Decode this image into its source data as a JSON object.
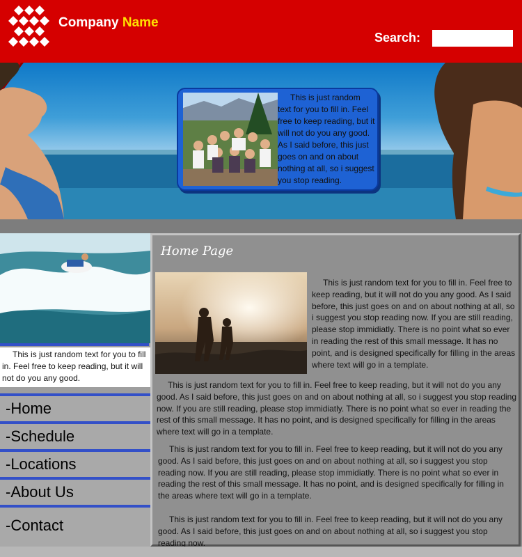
{
  "header": {
    "brand_first": "Company",
    "brand_second": "Name",
    "search_label": "Search:",
    "search_value": ""
  },
  "hero": {
    "card_text": "This is just random text for you to fill in.  Feel free to keep reading, but it will not do you any good.  As I said before, this just goes on and on about nothing at all, so i suggest you stop reading."
  },
  "sidebar": {
    "blurb": "This is just random text for you to fill in.  Feel free to keep reading, but it will not do you any good.",
    "nav": [
      {
        "label": "-Home"
      },
      {
        "label": "-Schedule"
      },
      {
        "label": "-Locations"
      },
      {
        "label": "-About Us"
      },
      {
        "label": "-Contact"
      }
    ]
  },
  "main": {
    "title": "Home Page",
    "paragraphs": [
      "This is just random text for you to fill in.  Feel free to keep reading, but it will not do you any good.  As I said before, this just goes on and on about nothing at all, so i suggest you stop reading now.  If you are still reading, please stop immidiatly.  There is no point what so ever in reading the rest of this small message.  It has no point, and is designed specifically for filling in the areas where text will go in a template.",
      "This is just random text for you to fill in.  Feel free to keep reading, but it will not do you any good.  As I said before, this just goes on and on about nothing at all, so i suggest you stop reading now.  If you are still reading, please stop immidiatly.  There is no point what so ever in reading the rest of this small message.  It has no point, and is designed specifically for filling in the areas where text will go in a template.",
      "This is just random text for you to fill in.  Feel free to keep reading, but it will not do you any good.  As I said before, this just goes on and on about nothing at all, so i suggest you stop reading now.  If you are still reading, please stop immidiatly.  There is no point what so ever in reading the rest of this small message.  It has no point, and is designed specifically for filling in the areas where text will go in a template.",
      "This is just random text for you to fill in.  Feel free to keep reading, but it will not do you any good.  As I said before, this just goes on and on about nothing at all, so i suggest you stop reading now."
    ]
  },
  "colors": {
    "header_red": "#d50000",
    "brand_accent": "#ffe000",
    "nav_rule": "#3350c8",
    "card_blue": "#1e62d4"
  },
  "icons": {
    "logo": "diamond-grid-logo-icon"
  }
}
